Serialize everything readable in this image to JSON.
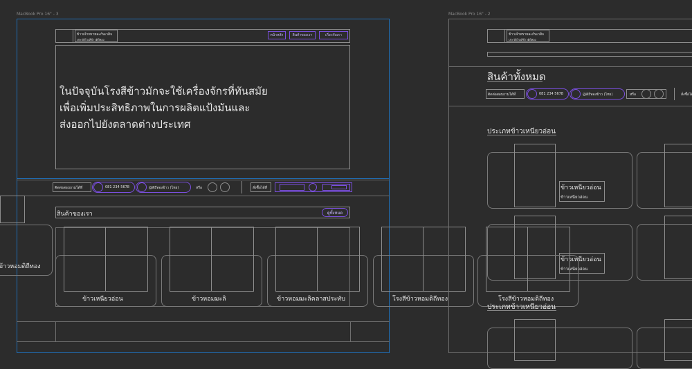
{
  "frames": {
    "left_label": "MacBook Pro 16\" - 3",
    "right_label": "MacBook Pro 16\" - 2"
  },
  "left": {
    "logo_text_line1": "ข้าวเจ้าพรายละกันเวสิจ",
    "logo_text_line2": "ประวัติโรงสีข้าวดิถีทอง",
    "nav": [
      "หน้าหลัก",
      "สินค้าของเรา",
      "เกี่ยวกับเรา"
    ],
    "hero_lines": [
      "ในปัจจุบันโรงสีข้าวมักจะใช้เครื่องจักรที่ทันสมัย",
      "เพื่อเพิ่มประสิทธิภาพในการผลิตแป้งมันและ",
      "ส่งออกไปยังตลาดต่างประเทศ"
    ],
    "contact_label": "ติดต่อสอบถามได้ที่",
    "phone": "081 234 5678",
    "line_id": "@ดิถีทองข้าว (ไทย)",
    "or_text": "หรือ",
    "order_label": "สั่งซื้อได้ที่",
    "section_title": "สินค้าของเรา",
    "see_all": "ดูทั้งหมด",
    "cards": [
      "ข้าวเหนียวอ่อน",
      "ข้าวหอมมะลิ",
      "ข้าวหอมมะลิคลาสประทับ",
      "โรงสีข้าวหอมดิถีทอง"
    ],
    "side_card_label": "ข้าวหอมดิถีทอง"
  },
  "right": {
    "logo_text_line1": "ข้าวเจ้าพรายละกันเวสิจ",
    "logo_text_line2": "ประวัติโรงสีข้าวดิถีทอง",
    "page_title": "สินค้าทั้งหมด",
    "contact_label": "ติดต่อสอบถามได้ที่",
    "phone": "081 234 5678",
    "line_id": "@ดิถีทองข้าว (ไทย)",
    "or_text": "หรือ",
    "order_label": "สั่งซื้อได้ที่",
    "category1": "ประเภทข้าวเหนียวอ่อน",
    "product_name": "ข้าวเหนียวอ่อน",
    "product_sub": "ข้าวเหนียวอ่อน",
    "product_name2": "ข้าวเหนียวอ่อน",
    "product_sub2": "ข้าวเหนียวอ่อน",
    "overlay_card": "โรงสีข้าวหอมดิถีทอง",
    "category2": "ประเภทข้าวเหนียวอ่อน"
  }
}
